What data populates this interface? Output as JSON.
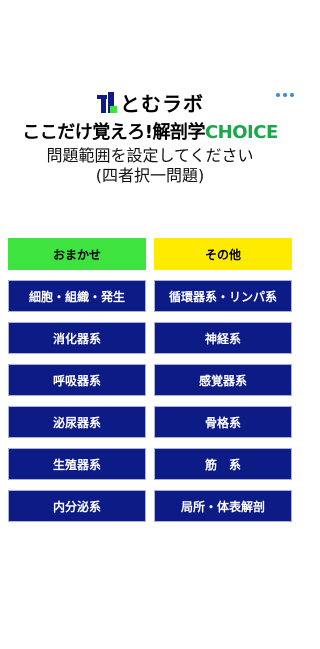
{
  "logo": {
    "text": "とむラボ"
  },
  "title": {
    "main": "ここだけ覚えろ!解剖学",
    "accent": "CHOICE"
  },
  "instruction": {
    "line1": "問題範囲を設定してください",
    "line2": "(四者択一問題)"
  },
  "options": {
    "random": "おまかせ",
    "other": "その他",
    "categories": [
      "細胞・組織・発生",
      "循環器系・リンパ系",
      "消化器系",
      "神経系",
      "呼吸器系",
      "感覚器系",
      "泌尿器系",
      "骨格系",
      "生殖器系",
      "筋　系",
      "内分泌系",
      "局所・体表解剖"
    ]
  },
  "colors": {
    "navy": "#0c1b86",
    "green": "#3fe33f",
    "yellow": "#ffeb00",
    "accent_green": "#1aa84a"
  }
}
